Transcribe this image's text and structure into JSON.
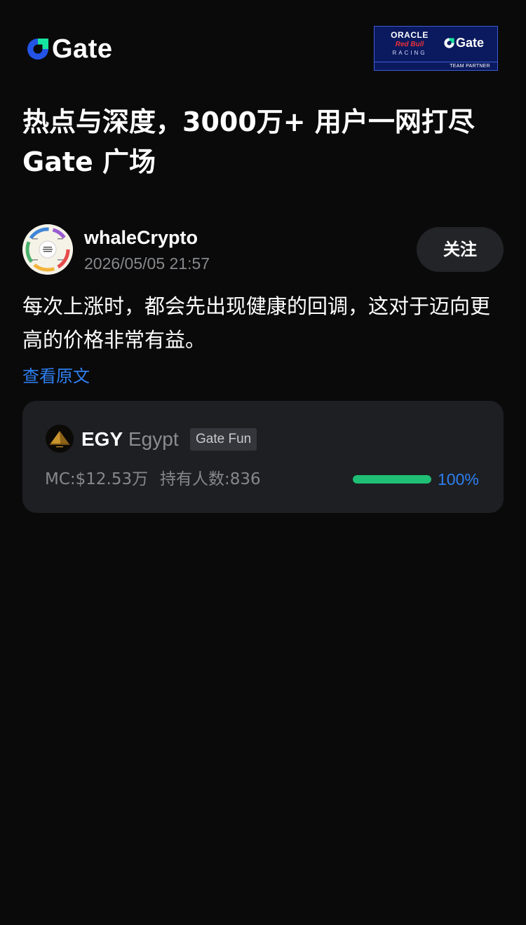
{
  "header": {
    "logo_text": "Gate",
    "partner": {
      "oracle": "ORACLE",
      "redbull": "Red Bull",
      "racing": "RACING",
      "gate": "Gate",
      "team_partner": "TEAM PARTNER"
    }
  },
  "headline": "热点与深度，3000万+ 用户一网打尽 Gate 广场",
  "post": {
    "author": "whaleCrypto",
    "timestamp": "2026/05/05 21:57",
    "follow_label": "关注",
    "text": "每次上涨时，都会先出现健康的回调，这对于迈向更高的价格非常有益。",
    "view_original_label": "查看原文"
  },
  "token_card": {
    "symbol": "EGY",
    "name": "Egypt",
    "tag": "Gate Fun",
    "market_cap": "MC:$12.53万",
    "holders": "持有人数:836",
    "progress_percent": 100,
    "progress_label": "100%"
  },
  "colors": {
    "background": "#0a0a0a",
    "card": "#1d1f23",
    "accent_blue": "#2f7ff0",
    "progress_green": "#1fbf75",
    "muted_text": "#86888c"
  }
}
